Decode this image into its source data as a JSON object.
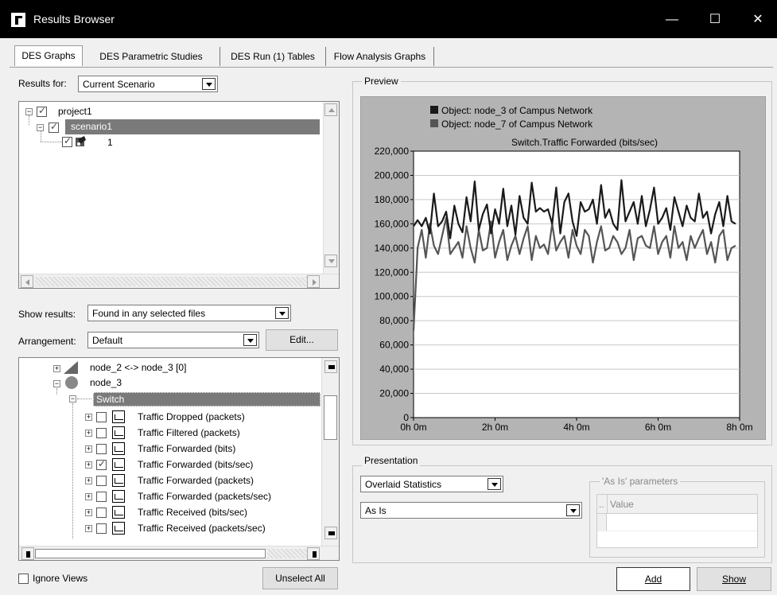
{
  "window": {
    "title": "Results Browser",
    "controls": {
      "minimize": "—",
      "maximize": "☐",
      "close": "✕"
    }
  },
  "tabs": [
    "DES Graphs",
    "DES Parametric Studies",
    "DES Run (1) Tables",
    "Flow Analysis Graphs"
  ],
  "results_for": {
    "label": "Results for:",
    "value": "Current Scenario"
  },
  "scenario_tree": [
    {
      "label": "project1",
      "checked": true
    },
    {
      "label": "scenario1",
      "checked": true,
      "selected": true
    },
    {
      "label": "1",
      "checked": true
    }
  ],
  "show_results": {
    "label": "Show results:",
    "value": "Found in any selected files"
  },
  "arrangement": {
    "label": "Arrangement:",
    "value": "Default",
    "edit_label": "Edit..."
  },
  "stats_tree": {
    "nodes": [
      {
        "label": "node_2 <-> node_3 [0]"
      },
      {
        "label": "node_3"
      },
      {
        "label": "Switch",
        "selected": true
      }
    ],
    "items": [
      {
        "label": "Traffic Dropped (packets)",
        "checked": false
      },
      {
        "label": "Traffic Filtered (packets)",
        "checked": false
      },
      {
        "label": "Traffic Forwarded (bits)",
        "checked": false
      },
      {
        "label": "Traffic Forwarded (bits/sec)",
        "checked": true
      },
      {
        "label": "Traffic Forwarded (packets)",
        "checked": false
      },
      {
        "label": "Traffic Forwarded (packets/sec)",
        "checked": false
      },
      {
        "label": "Traffic Received (bits/sec)",
        "checked": false
      },
      {
        "label": "Traffic Received (packets/sec)",
        "checked": false
      }
    ]
  },
  "bottom_left": {
    "ignore_views": "Ignore Views",
    "unselect_all": "Unselect All"
  },
  "preview": {
    "group_label": "Preview"
  },
  "chart_data": {
    "type": "line",
    "title": "Switch.Traffic Forwarded (bits/sec)",
    "xlabel": "",
    "ylabel": "",
    "x_ticks": [
      "0h 0m",
      "2h 0m",
      "4h 0m",
      "6h 0m",
      "8h 0m"
    ],
    "y_ticks": [
      "0",
      "20,000",
      "40,000",
      "60,000",
      "80,000",
      "100,000",
      "120,000",
      "140,000",
      "160,000",
      "180,000",
      "200,000",
      "220,000"
    ],
    "xlim_hours": [
      0,
      8
    ],
    "ylim": [
      0,
      220000
    ],
    "grid": true,
    "legend_position": "top",
    "colors": {
      "plot_bg": "#ffffff",
      "frame_bg": "#b4b4b4",
      "grid": "#c8c8c8"
    },
    "series": [
      {
        "name": "Object: node_3 of Campus Network",
        "color": "#1a1a1a",
        "x": [
          0,
          0.1,
          0.2,
          0.3,
          0.4,
          0.5,
          0.6,
          0.7,
          0.8,
          0.9,
          1.0,
          1.1,
          1.2,
          1.3,
          1.4,
          1.5,
          1.6,
          1.7,
          1.8,
          1.9,
          2.0,
          2.1,
          2.2,
          2.3,
          2.4,
          2.5,
          2.6,
          2.7,
          2.8,
          2.9,
          3.0,
          3.1,
          3.2,
          3.3,
          3.4,
          3.5,
          3.6,
          3.7,
          3.8,
          3.9,
          4.0,
          4.1,
          4.2,
          4.3,
          4.4,
          4.5,
          4.6,
          4.7,
          4.8,
          4.9,
          5.0,
          5.1,
          5.2,
          5.3,
          5.4,
          5.5,
          5.6,
          5.7,
          5.8,
          5.9,
          6.0,
          6.1,
          6.2,
          6.3,
          6.4,
          6.5,
          6.6,
          6.7,
          6.8,
          6.9,
          7.0,
          7.1,
          7.2,
          7.3,
          7.4,
          7.5,
          7.6,
          7.7,
          7.8,
          7.9
        ],
        "y": [
          158000,
          163000,
          158000,
          165000,
          152000,
          185000,
          158000,
          162000,
          170000,
          148000,
          175000,
          160000,
          153000,
          182000,
          162000,
          195000,
          155000,
          168000,
          176000,
          152000,
          172000,
          160000,
          189000,
          158000,
          175000,
          151000,
          183000,
          165000,
          160000,
          194000,
          170000,
          173000,
          170000,
          172000,
          160000,
          190000,
          152000,
          178000,
          185000,
          162000,
          150000,
          178000,
          170000,
          172000,
          180000,
          160000,
          192000,
          165000,
          172000,
          160000,
          155000,
          196000,
          162000,
          170000,
          178000,
          160000,
          183000,
          158000,
          172000,
          190000,
          160000,
          165000,
          173000,
          155000,
          182000,
          170000,
          158000,
          175000,
          165000,
          162000,
          185000,
          165000,
          170000,
          152000,
          168000,
          178000,
          158000,
          183000,
          162000,
          160000
        ]
      },
      {
        "name": "Object: node_7 of Campus Network",
        "color": "#555555",
        "x": [
          0,
          0.1,
          0.2,
          0.3,
          0.4,
          0.5,
          0.6,
          0.7,
          0.8,
          0.9,
          1.0,
          1.1,
          1.2,
          1.3,
          1.4,
          1.5,
          1.6,
          1.7,
          1.8,
          1.9,
          2.0,
          2.1,
          2.2,
          2.3,
          2.4,
          2.5,
          2.6,
          2.7,
          2.8,
          2.9,
          3.0,
          3.1,
          3.2,
          3.3,
          3.4,
          3.5,
          3.6,
          3.7,
          3.8,
          3.9,
          4.0,
          4.1,
          4.2,
          4.3,
          4.4,
          4.5,
          4.6,
          4.7,
          4.8,
          4.9,
          5.0,
          5.1,
          5.2,
          5.3,
          5.4,
          5.5,
          5.6,
          5.7,
          5.8,
          5.9,
          6.0,
          6.1,
          6.2,
          6.3,
          6.4,
          6.5,
          6.6,
          6.7,
          6.8,
          6.9,
          7.0,
          7.1,
          7.2,
          7.3,
          7.4,
          7.5,
          7.6,
          7.7,
          7.8,
          7.9
        ],
        "y": [
          72000,
          140000,
          155000,
          132000,
          160000,
          142000,
          135000,
          150000,
          165000,
          135000,
          140000,
          145000,
          132000,
          158000,
          140000,
          128000,
          155000,
          138000,
          140000,
          162000,
          132000,
          145000,
          155000,
          130000,
          142000,
          150000,
          135000,
          148000,
          158000,
          130000,
          150000,
          140000,
          143000,
          135000,
          160000,
          138000,
          145000,
          150000,
          132000,
          155000,
          142000,
          135000,
          155000,
          150000,
          128000,
          145000,
          158000,
          138000,
          140000,
          150000,
          145000,
          135000,
          140000,
          155000,
          130000,
          148000,
          150000,
          142000,
          140000,
          158000,
          135000,
          145000,
          150000,
          132000,
          158000,
          140000,
          145000,
          130000,
          150000,
          140000,
          148000,
          155000,
          135000,
          145000,
          128000,
          150000,
          155000,
          130000,
          140000,
          142000
        ]
      }
    ]
  },
  "presentation": {
    "group_label": "Presentation",
    "mode": "Overlaid Statistics",
    "filter": "As Is",
    "as_is_params_label": "'As Is' parameters",
    "params_col1": "..",
    "params_col2": "Value"
  },
  "actions": {
    "add": "Add",
    "show": "Show"
  }
}
